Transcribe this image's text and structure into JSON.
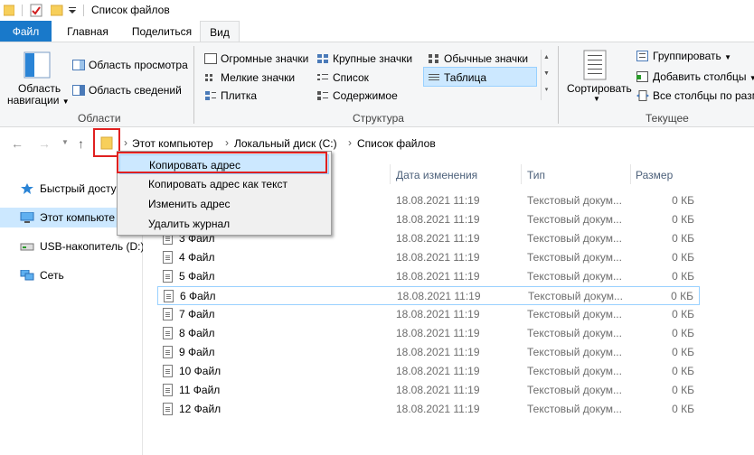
{
  "window": {
    "title": "Список файлов"
  },
  "tabs": [
    {
      "label": "Файл"
    },
    {
      "label": "Главная"
    },
    {
      "label": "Поделиться"
    },
    {
      "label": "Вид"
    }
  ],
  "ribbon": {
    "panes": {
      "nav_pane_label_1": "Область",
      "nav_pane_label_2": "навигации",
      "preview": "Область просмотра",
      "details": "Область сведений",
      "group_label": "Области"
    },
    "layout": {
      "huge_icons": "Огромные значки",
      "large_icons": "Крупные значки",
      "medium_icons": "Обычные значки",
      "small_icons": "Мелкие значки",
      "list": "Список",
      "details": "Таблица",
      "tiles": "Плитка",
      "content": "Содержимое",
      "group_label": "Структура"
    },
    "current_view": {
      "sort": "Сортировать",
      "group_by": "Группировать",
      "add_columns": "Добавить столбцы",
      "fit_columns": "Все столбцы по разм",
      "group_label": "Текущее представлен"
    }
  },
  "breadcrumb": [
    "Этот компьютер",
    "Локальный диск (C:)",
    "Список файлов"
  ],
  "nav_pane": [
    {
      "label": "Быстрый досту"
    },
    {
      "label": "Этот компьюте"
    },
    {
      "label": "USB-накопитель (D:)"
    },
    {
      "label": "Сеть"
    }
  ],
  "columns": {
    "date": "Дата изменения",
    "type": "Тип",
    "size": "Размер"
  },
  "files": [
    {
      "name": "",
      "date": "18.08.2021 11:19",
      "type": "Текстовый докум...",
      "size": "0 КБ"
    },
    {
      "name": "",
      "date": "18.08.2021 11:19",
      "type": "Текстовый докум...",
      "size": "0 КБ"
    },
    {
      "name": "3 Файл",
      "date": "18.08.2021 11:19",
      "type": "Текстовый докум...",
      "size": "0 КБ"
    },
    {
      "name": "4 Файл",
      "date": "18.08.2021 11:19",
      "type": "Текстовый докум...",
      "size": "0 КБ"
    },
    {
      "name": "5 Файл",
      "date": "18.08.2021 11:19",
      "type": "Текстовый докум...",
      "size": "0 КБ"
    },
    {
      "name": "6 Файл",
      "date": "18.08.2021 11:19",
      "type": "Текстовый докум...",
      "size": "0 КБ"
    },
    {
      "name": "7 Файл",
      "date": "18.08.2021 11:19",
      "type": "Текстовый докум...",
      "size": "0 КБ"
    },
    {
      "name": "8 Файл",
      "date": "18.08.2021 11:19",
      "type": "Текстовый докум...",
      "size": "0 КБ"
    },
    {
      "name": "9 Файл",
      "date": "18.08.2021 11:19",
      "type": "Текстовый докум...",
      "size": "0 КБ"
    },
    {
      "name": "10 Файл",
      "date": "18.08.2021 11:19",
      "type": "Текстовый докум...",
      "size": "0 КБ"
    },
    {
      "name": "11 Файл",
      "date": "18.08.2021 11:19",
      "type": "Текстовый докум...",
      "size": "0 КБ"
    },
    {
      "name": "12 Файл",
      "date": "18.08.2021 11:19",
      "type": "Текстовый докум...",
      "size": "0 КБ"
    }
  ],
  "context_menu": [
    {
      "label": "Копировать адрес"
    },
    {
      "label": "Копировать адрес как текст"
    },
    {
      "label": "Изменить адрес"
    },
    {
      "label": "Удалить журнал"
    }
  ],
  "colors": {
    "accent": "#1979ca",
    "highlight": "#e02020",
    "selection": "#cce8ff"
  }
}
